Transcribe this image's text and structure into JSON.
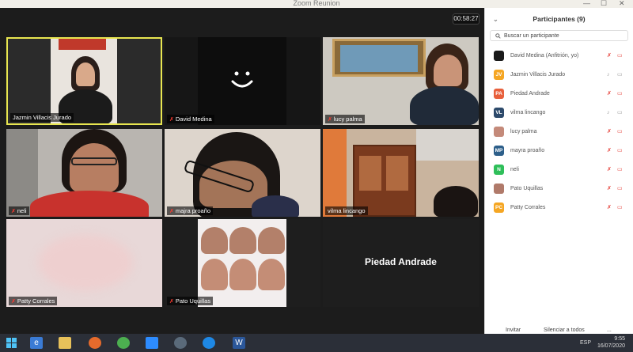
{
  "window": {
    "title": "Zoom Reunion",
    "minimize": "—",
    "maximize": "☐",
    "close": "✕"
  },
  "meeting": {
    "timer": "00:58:27",
    "tiles": [
      {
        "name": "Jazmin Villacis Jurado",
        "muted": false,
        "active_speaker": true
      },
      {
        "name": "David Medina",
        "muted": true
      },
      {
        "name": "lucy palma",
        "muted": true
      },
      {
        "name": "neli",
        "muted": true
      },
      {
        "name": "majra proaño",
        "muted": true
      },
      {
        "name": "vilma lincango",
        "muted": false
      },
      {
        "name": "Patty Corrales",
        "muted": true
      },
      {
        "name": "Pato Uquillas",
        "muted": true
      },
      {
        "name": "",
        "big_name": "Piedad Andrade"
      }
    ]
  },
  "participants": {
    "title": "Participantes (9)",
    "search_placeholder": "Buscar un participante",
    "list": [
      {
        "initials": "",
        "name": "David Medina (Anfitrión, yo)",
        "color": "#1a1a1a",
        "mic": "muted",
        "cam": "off"
      },
      {
        "initials": "JV",
        "name": "Jazmin Villacis Jurado",
        "color": "#f5a623",
        "mic": "on",
        "cam": "off"
      },
      {
        "initials": "PA",
        "name": "Piedad Andrade",
        "color": "#e8603c",
        "mic": "muted",
        "cam": "off"
      },
      {
        "initials": "VL",
        "name": "vilma lincango",
        "color": "#2d4a6b",
        "mic": "on",
        "cam": "off"
      },
      {
        "initials": "",
        "name": "lucy palma",
        "color": "#c48a7a",
        "mic": "muted",
        "cam": "off"
      },
      {
        "initials": "MP",
        "name": "mayra proaño",
        "color": "#2d5f8a",
        "mic": "muted",
        "cam": "off"
      },
      {
        "initials": "N",
        "name": "neli",
        "color": "#2fbf5a",
        "mic": "muted",
        "cam": "off"
      },
      {
        "initials": "",
        "name": "Pato Uquillas",
        "color": "#b07a6a",
        "mic": "muted",
        "cam": "off"
      },
      {
        "initials": "PC",
        "name": "Patty Corrales",
        "color": "#f5a623",
        "mic": "muted",
        "cam": "off"
      }
    ],
    "footer": {
      "invite": "Invitar",
      "mute_all": "Silenciar a todos",
      "more": "..."
    }
  },
  "taskbar": {
    "lang": "ESP",
    "time": "9:55",
    "date": "16/07/2020"
  }
}
